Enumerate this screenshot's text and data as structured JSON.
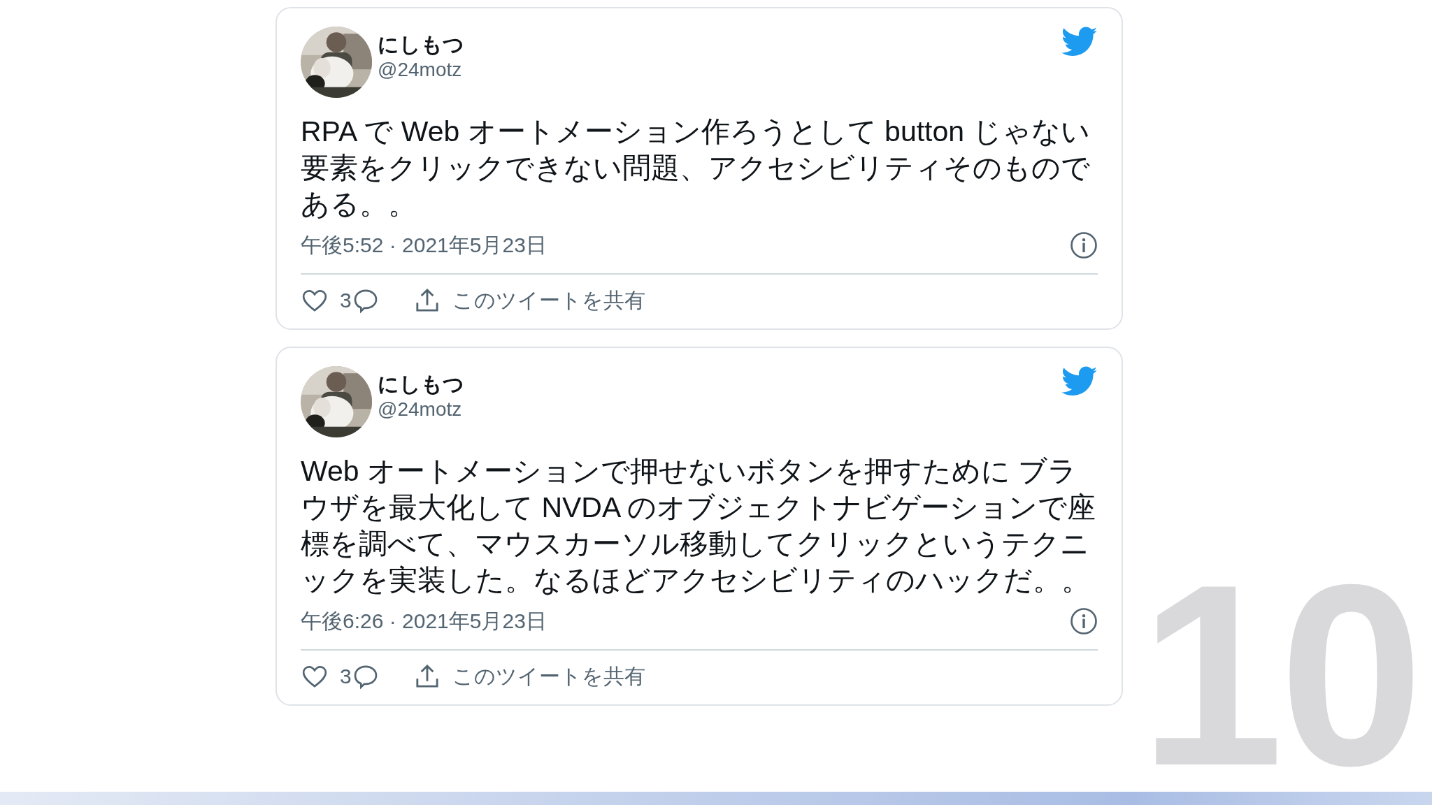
{
  "tweets": [
    {
      "author": {
        "name": "にしもつ",
        "handle": "@24motz"
      },
      "text": "RPA で Web オートメーション作ろうとして button じゃない要素をクリックできない問題、アクセシビリティそのものである。。",
      "timestamp": "午後5:52 · 2021年5月23日",
      "likes": "3",
      "share_label": "このツイートを共有"
    },
    {
      "author": {
        "name": "にしもつ",
        "handle": "@24motz"
      },
      "text": "Web オートメーションで押せないボタンを押すために ブラウザを最大化して NVDA のオブジェクトナビゲーションで座標を調べて、マウスカーソル移動してクリックというテクニックを実装した。なるほどアクセシビリティのハックだ。。",
      "timestamp": "午後6:26 · 2021年5月23日",
      "likes": "3",
      "share_label": "このツイートを共有"
    }
  ],
  "slide_number": "10"
}
